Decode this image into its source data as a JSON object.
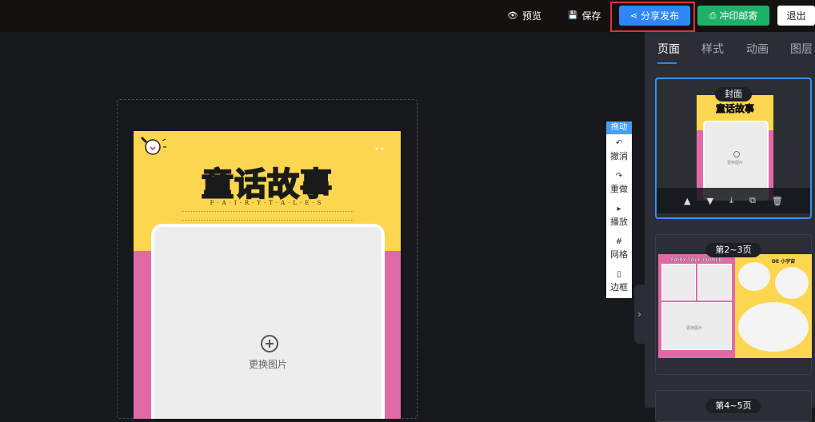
{
  "topbar": {
    "preview_label": "预览",
    "save_label": "保存",
    "share_label": "分享发布",
    "print_label": "冲印邮寄",
    "exit_label": "退出"
  },
  "canvas": {
    "page": {
      "title": "童话故事",
      "subtitle": "F·A·I·R·Y·T·A·L·E·S",
      "photo_label": "更换图片"
    }
  },
  "tools": {
    "drag_label": "拖动",
    "items": [
      {
        "label": "撤消",
        "icon": "↶"
      },
      {
        "label": "重做",
        "icon": "↷"
      },
      {
        "label": "播放",
        "icon": "▸"
      },
      {
        "label": "网格",
        "icon": "#"
      },
      {
        "label": "边框",
        "icon": "▯"
      }
    ]
  },
  "panel": {
    "tabs": [
      "页面",
      "样式",
      "动画",
      "图层"
    ],
    "active_tab": "页面",
    "cards": [
      {
        "label": "封面",
        "thumb_title": "童话故事",
        "photo_label": "更换图片"
      },
      {
        "label": "第2~3页",
        "left_title": "FAIRY TALE WORLD",
        "right_title": "DE 小宇宙",
        "photo_label": "更换图片"
      },
      {
        "label": "第4~5页"
      }
    ],
    "card_actions": [
      "▲",
      "▼",
      "⤓",
      "⧉",
      "🗑"
    ]
  },
  "colors": {
    "share_bg": "#2f86f6",
    "print_bg": "#1fb06a",
    "highlight": "#e0303a",
    "page_yellow": "#fbd64e",
    "page_pink": "#e06aa8"
  }
}
